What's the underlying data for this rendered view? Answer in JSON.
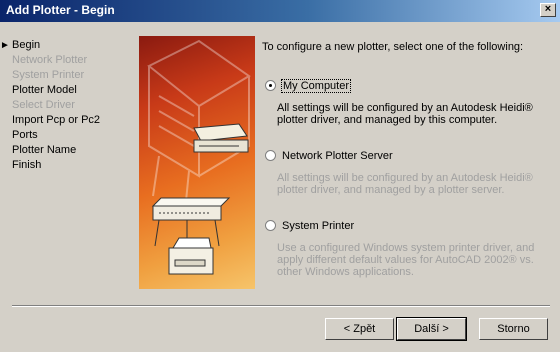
{
  "window": {
    "title": "Add Plotter - Begin",
    "close_glyph": "×"
  },
  "steps": [
    {
      "label": "Begin",
      "state": "current"
    },
    {
      "label": "Network Plotter",
      "state": "disabled"
    },
    {
      "label": "System Printer",
      "state": "disabled"
    },
    {
      "label": "Plotter Model",
      "state": "enabled"
    },
    {
      "label": "Select Driver",
      "state": "disabled"
    },
    {
      "label": "Import Pcp or Pc2",
      "state": "enabled"
    },
    {
      "label": "Ports",
      "state": "enabled"
    },
    {
      "label": "Plotter Name",
      "state": "enabled"
    },
    {
      "label": "Finish",
      "state": "enabled"
    }
  ],
  "intro": "To configure a new plotter, select one of the following:",
  "options": {
    "my_computer": {
      "label": "My Computer",
      "selected": true,
      "description": "All settings will be configured by an Autodesk Heidi® plotter driver, and managed by this computer."
    },
    "network": {
      "label": "Network Plotter Server",
      "selected": false,
      "description": "All settings will be configured by an Autodesk Heidi® plotter driver, and managed by a plotter server."
    },
    "system": {
      "label": "System Printer",
      "selected": false,
      "description": "Use a configured Windows system printer driver, and apply different default values for AutoCAD 2002® vs. other Windows applications."
    }
  },
  "buttons": {
    "back": "< Zpět",
    "next": "Další >",
    "cancel": "Storno"
  },
  "colors": {
    "title_start": "#0a246a",
    "title_end": "#a6caf0",
    "dialog_bg": "#d4d0c8"
  }
}
